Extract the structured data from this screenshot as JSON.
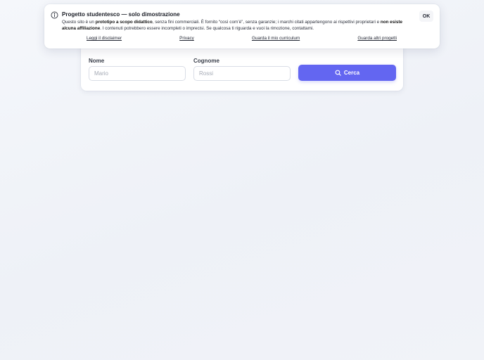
{
  "banner": {
    "title": "Progetto studentesco — solo dimostrazione",
    "text": {
      "p1": "Questo sito è un ",
      "b1": "prototipo a scopo didattico",
      "p2": ", senza fini commerciali. È fornito “così com’è”, senza garanzie; i marchi citati appartengono ai rispettivi proprietari e ",
      "b2": "non esiste alcuna affiliazione",
      "p3": ". I contenuti potrebbero essere incompleti o imprecisi. Se qualcosa ti riguarda e vuoi la rimozione, contattami."
    },
    "ok_label": "OK",
    "links": [
      {
        "label": "Leggi il disclaimer"
      },
      {
        "label": "Privacy"
      },
      {
        "label": "Guarda il mio curriculum"
      },
      {
        "label": "Guarda altri progetti"
      }
    ],
    "icon": "info-icon"
  },
  "search": {
    "first_name": {
      "label": "Nome",
      "placeholder": "Mario"
    },
    "last_name": {
      "label": "Cognome",
      "placeholder": "Rossi"
    },
    "button_label": "Cerca",
    "button_icon": "search-icon",
    "accent_color": "#6366f1"
  }
}
